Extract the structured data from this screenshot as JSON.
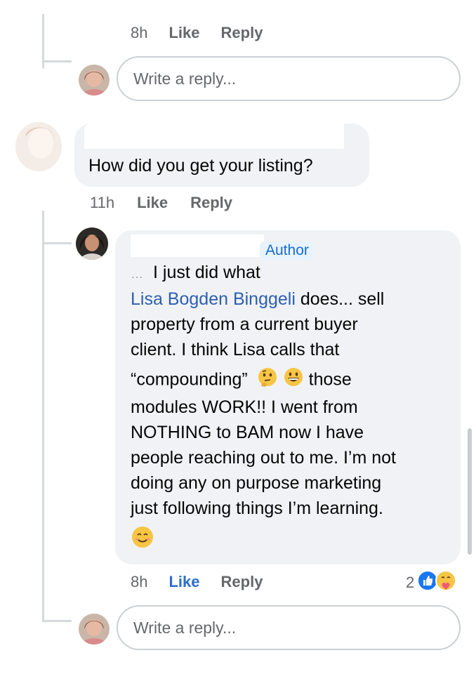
{
  "comment_top": {
    "time": "8h",
    "like": "Like",
    "reply": "Reply",
    "reply_placeholder": "Write a reply..."
  },
  "comment_main": {
    "text": "How did you get your listing?",
    "time": "11h",
    "like": "Like",
    "reply": "Reply"
  },
  "reply": {
    "badge": "Author",
    "name_fragment": "…",
    "lines": [
      {
        "pre": "I just did what",
        "link": "",
        "post": ""
      },
      {
        "pre": "",
        "link": "Lisa Bogden Binggeli",
        "post": " does... sell"
      },
      {
        "pre": "property from a current buyer",
        "link": "",
        "post": ""
      },
      {
        "pre": "client. I think Lisa calls that",
        "link": "",
        "post": ""
      },
      {
        "pre": "“compounding”",
        "link": "",
        "post": " those"
      },
      {
        "pre": "modules WORK!! I went from",
        "link": "",
        "post": ""
      },
      {
        "pre": "NOTHING to BAM now I have",
        "link": "",
        "post": ""
      },
      {
        "pre": "people reaching out to me. I’m not",
        "link": "",
        "post": ""
      },
      {
        "pre": "doing any on purpose marketing",
        "link": "",
        "post": ""
      },
      {
        "pre": "just following things I’m learning.",
        "link": "",
        "post": ""
      }
    ],
    "emoji_inline": [
      "thinking-face",
      "grinning-face"
    ],
    "emoji_end": "smiling-face",
    "time": "8h",
    "like": "Like",
    "reply": "Reply",
    "reaction_count": "2",
    "reaction_icons": [
      "like-reaction",
      "care-reaction"
    ]
  },
  "reply_box_bottom": {
    "placeholder": "Write a reply..."
  },
  "colors": {
    "bubble": "#f0f2f5",
    "link": "#2d5fb0",
    "like_active": "#2d6ecf",
    "meta": "#65676b"
  }
}
